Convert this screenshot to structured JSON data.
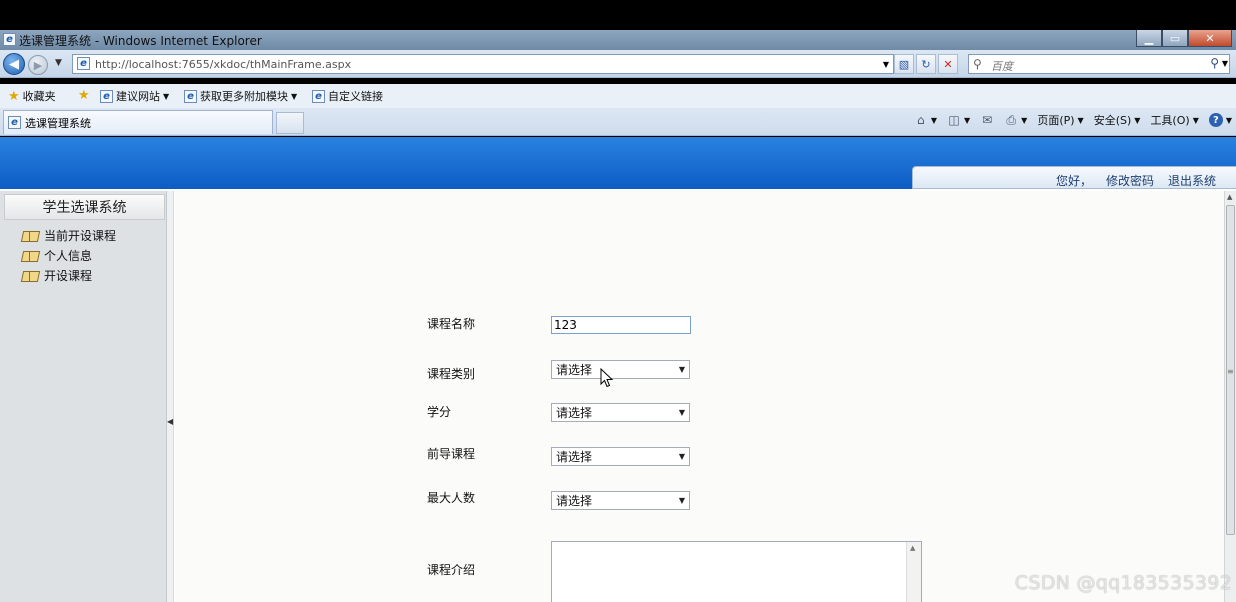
{
  "window": {
    "title": "选课管理系统 - Windows Internet Explorer",
    "minimize": "▁",
    "maximize": "▭",
    "close": "✕"
  },
  "navbar": {
    "url": "http://localhost:7655/xkdoc/thMainFrame.aspx",
    "search_placeholder": "百度"
  },
  "favorites": {
    "favorites_label": "收藏夹",
    "items": [
      "建议网站",
      "获取更多附加模块",
      "自定义链接"
    ]
  },
  "tabs": {
    "active_tab": "选课管理系统"
  },
  "commandbar": {
    "page": "页面(P)",
    "safety": "安全(S)",
    "tools": "工具(O)"
  },
  "header": {
    "greeting": "您好，",
    "change_password": "修改密码",
    "logout": "退出系统"
  },
  "sidebar": {
    "title": "学生选课系统",
    "items": [
      "当前开设课程",
      "个人信息",
      "开设课程"
    ]
  },
  "form": {
    "course_name_label": "课程名称",
    "course_name_value": "123",
    "course_type_label": "课程类别",
    "course_type_value": "请选择",
    "credit_label": "学分",
    "credit_value": "请选择",
    "prereq_label": "前导课程",
    "prereq_value": "请选择",
    "max_people_label": "最大人数",
    "max_people_value": "请选择",
    "intro_label": "课程介绍"
  },
  "watermark": "CSDN @qq183535392",
  "colors": {
    "banner": "#1a6fd6",
    "sidebar_bg": "#dde1e4",
    "content_bg": "#fbfcfa"
  }
}
